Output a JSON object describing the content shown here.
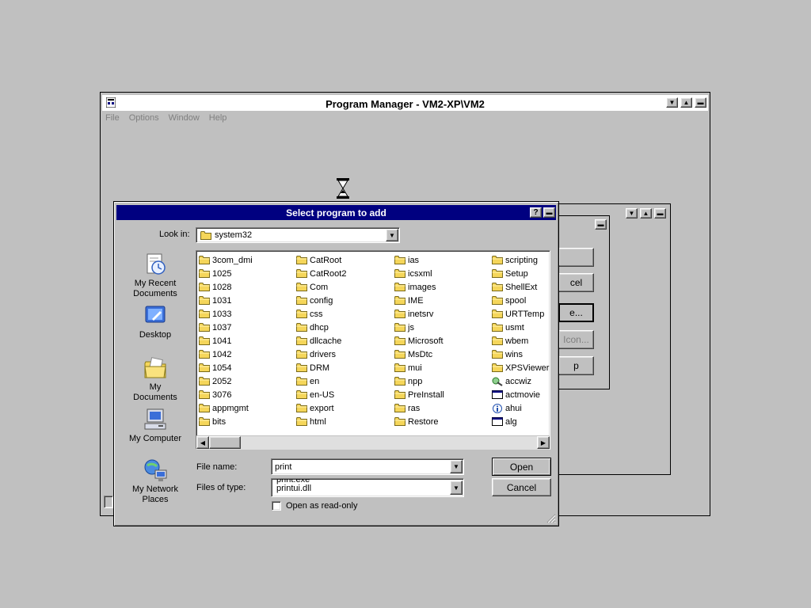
{
  "program_manager": {
    "title": "Program Manager - VM2-XP\\VM2",
    "menu": [
      "File",
      "Options",
      "Window",
      "Help"
    ]
  },
  "background_group": {
    "button_fragments": [
      "",
      "cel",
      "e...",
      "Icon...",
      "p"
    ]
  },
  "dialog": {
    "title": "Select program to add",
    "help_button": "?",
    "look_in_label": "Look in:",
    "look_in_value": "system32",
    "places": [
      {
        "label": "My Recent\nDocuments",
        "icon": "recent-documents-icon"
      },
      {
        "label": "Desktop",
        "icon": "desktop-icon"
      },
      {
        "label": "My Documents",
        "icon": "my-documents-icon"
      },
      {
        "label": "My Computer",
        "icon": "my-computer-icon"
      },
      {
        "label": "My Network\nPlaces",
        "icon": "network-places-icon"
      }
    ],
    "files": {
      "col1": [
        "3com_dmi",
        "1025",
        "1028",
        "1031",
        "1033",
        "1037",
        "1041",
        "1042",
        "1054",
        "2052",
        "3076",
        "appmgmt",
        "bits"
      ],
      "col2": [
        "CatRoot",
        "CatRoot2",
        "Com",
        "config",
        "css",
        "dhcp",
        "dllcache",
        "drivers",
        "DRM",
        "en",
        "en-US",
        "export",
        "html"
      ],
      "col3": [
        "ias",
        "icsxml",
        "images",
        "IME",
        "inetsrv",
        "js",
        "Microsoft",
        "MsDtc",
        "mui",
        "npp",
        "PreInstall",
        "ras",
        "Restore"
      ],
      "col4": [
        {
          "name": "scripting",
          "icon": "folder-icon"
        },
        {
          "name": "Setup",
          "icon": "folder-icon"
        },
        {
          "name": "ShellExt",
          "icon": "folder-icon"
        },
        {
          "name": "spool",
          "icon": "folder-icon"
        },
        {
          "name": "URTTemp",
          "icon": "folder-icon"
        },
        {
          "name": "usmt",
          "icon": "folder-icon"
        },
        {
          "name": "wbem",
          "icon": "folder-icon"
        },
        {
          "name": "wins",
          "icon": "folder-icon"
        },
        {
          "name": "XPSViewer",
          "icon": "folder-icon"
        },
        {
          "name": "accwiz",
          "icon": "accwiz-icon"
        },
        {
          "name": "actmovie",
          "icon": "exe-icon"
        },
        {
          "name": "ahui",
          "icon": "info-icon"
        },
        {
          "name": "alg",
          "icon": "exe-icon"
        }
      ]
    },
    "file_name_label": "File name:",
    "file_name_value": "print",
    "files_of_type_label": "Files of type:",
    "files_of_type_options": [
      "print.exe",
      "printui.dll"
    ],
    "read_only_label": "Open as read-only",
    "read_only_checked": false,
    "open_button": "Open",
    "cancel_button": "Cancel"
  },
  "colors": {
    "desktop": "#c0c0c0",
    "dialog_title": "#000080",
    "folder": "#f5d65a"
  }
}
